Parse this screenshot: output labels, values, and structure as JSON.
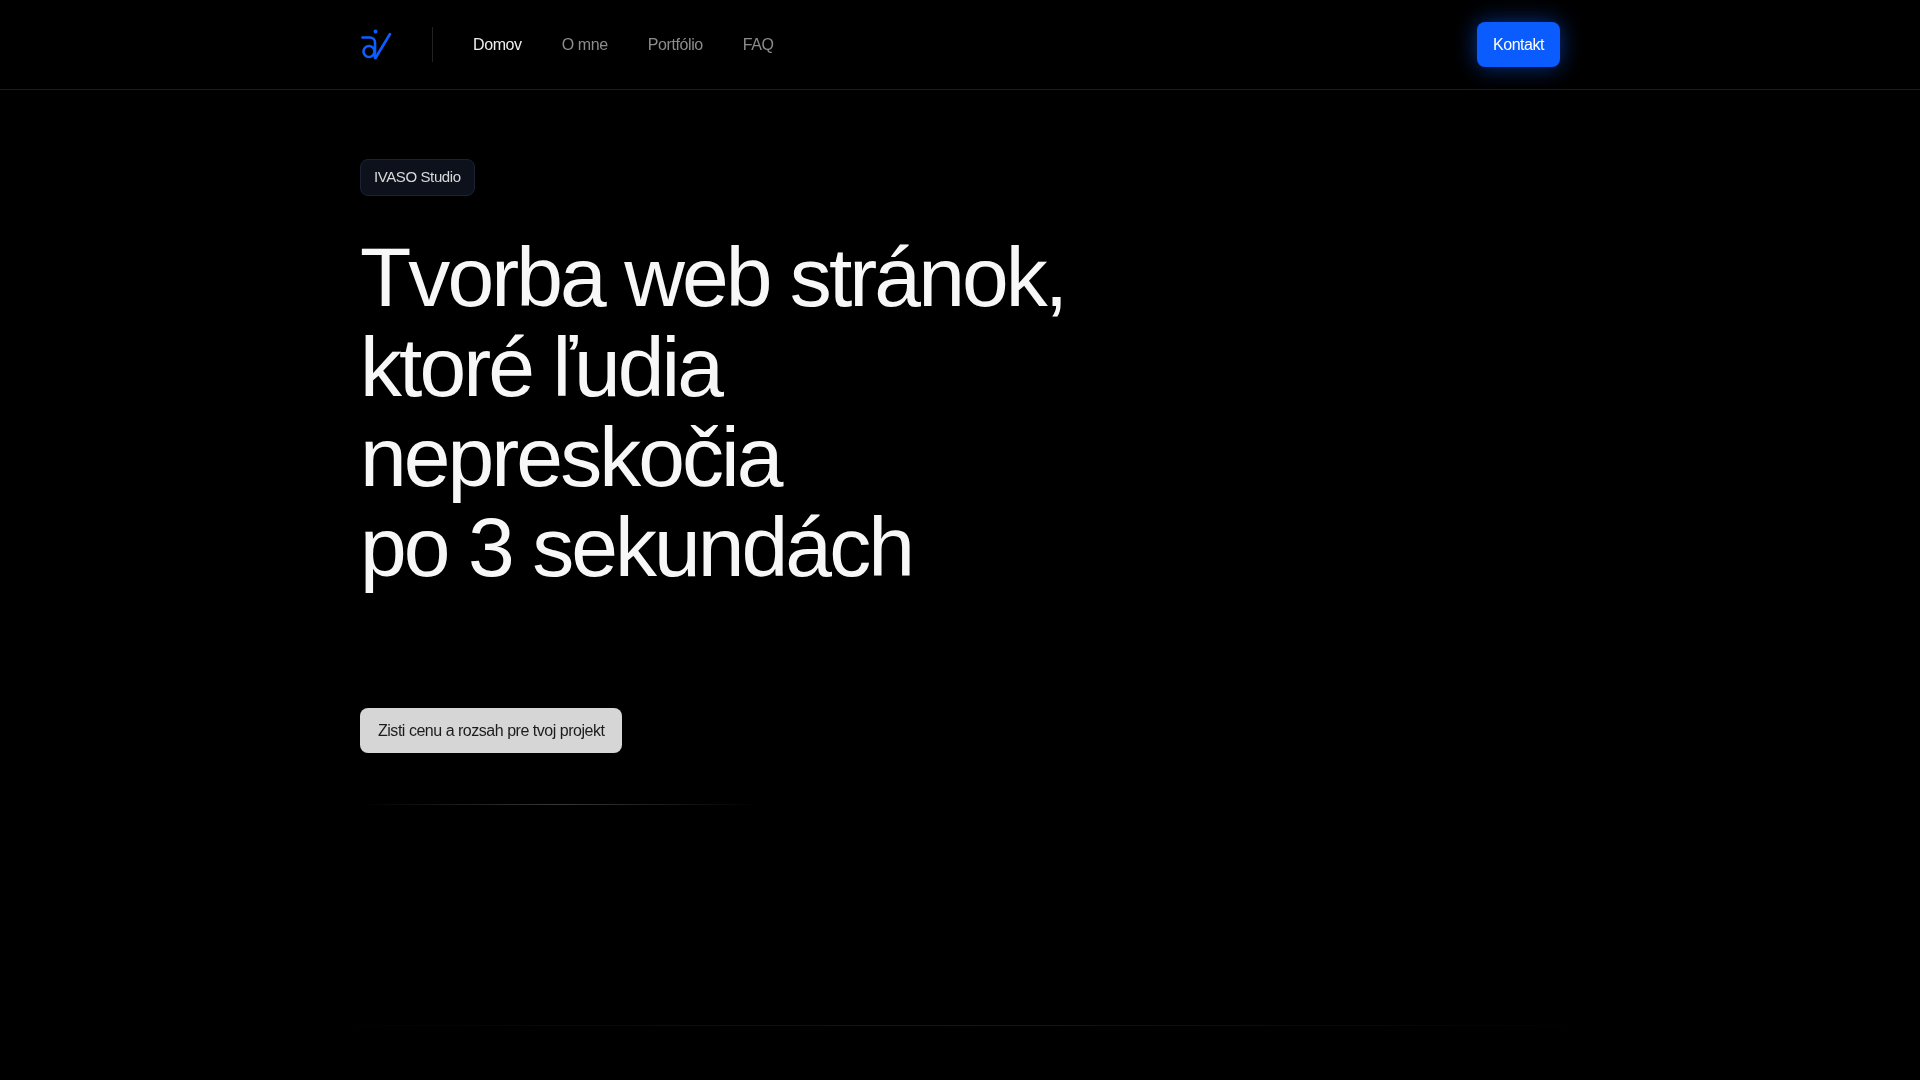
{
  "header": {
    "nav": [
      {
        "label": "Domov",
        "selected": true
      },
      {
        "label": "O mne",
        "selected": false
      },
      {
        "label": "Portfólio",
        "selected": false
      },
      {
        "label": "FAQ",
        "selected": false
      }
    ],
    "contact_button": "Kontakt"
  },
  "hero": {
    "badge": "IVASO Studio",
    "headline_lines": [
      "Tvorba web stránok,",
      "ktoré ľudia",
      "nepreskočia",
      "po 3 sekundách"
    ],
    "cta_button": "Zisti cenu a rozsah pre tvoj projekt"
  }
}
